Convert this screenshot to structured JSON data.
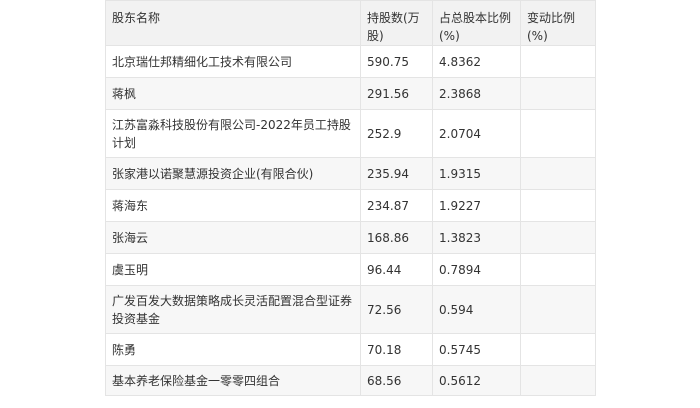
{
  "table": {
    "headers": [
      "股东名称",
      "持股数(万股)",
      "占总股本比例(%)",
      "变动比例(%)"
    ],
    "rows": [
      [
        "北京瑞仕邦精细化工技术有限公司",
        "590.75",
        "4.8362",
        ""
      ],
      [
        "蒋枫",
        "291.56",
        "2.3868",
        ""
      ],
      [
        "江苏富淼科技股份有限公司-2022年员工持股计划",
        "252.9",
        "2.0704",
        ""
      ],
      [
        "张家港以诺聚慧源投资企业(有限合伙)",
        "235.94",
        "1.9315",
        ""
      ],
      [
        "蒋海东",
        "234.87",
        "1.9227",
        ""
      ],
      [
        "张海云",
        "168.86",
        "1.3823",
        ""
      ],
      [
        "虞玉明",
        "96.44",
        "0.7894",
        ""
      ],
      [
        "广发百发大数据策略成长灵活配置混合型证券投资基金",
        "72.56",
        "0.594",
        ""
      ],
      [
        "陈勇",
        "70.18",
        "0.5745",
        ""
      ],
      [
        "基本养老保险基金一零零四组合",
        "68.56",
        "0.5612",
        ""
      ]
    ]
  }
}
